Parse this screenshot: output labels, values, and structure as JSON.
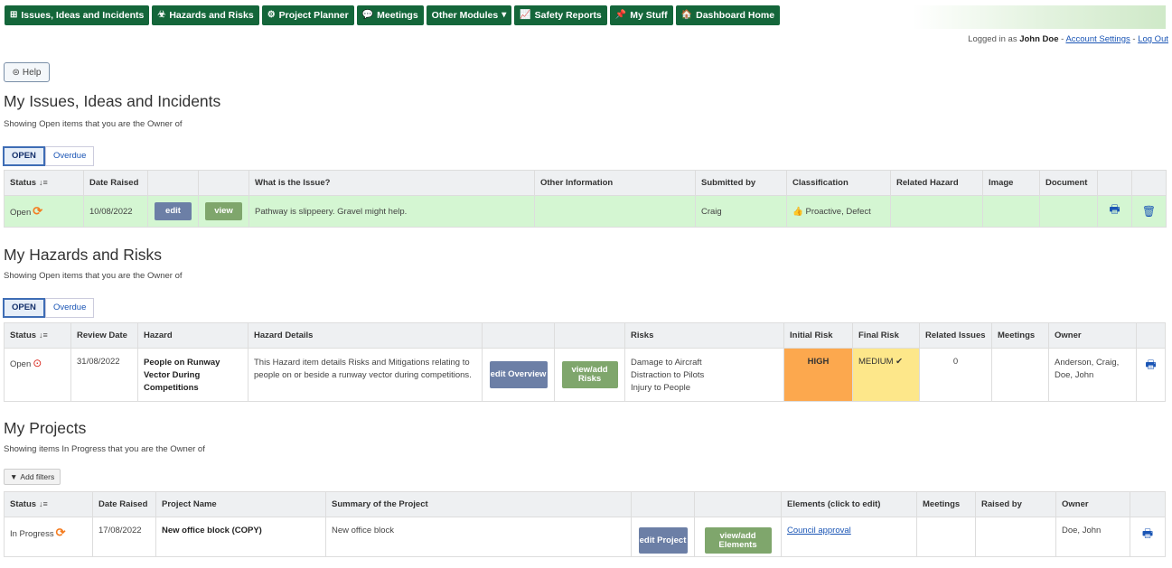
{
  "nav": {
    "items": [
      {
        "icon": "plus-square-icon",
        "glyph": "⊞",
        "label": "Issues, Ideas and Incidents"
      },
      {
        "icon": "biohazard-icon",
        "glyph": "☣",
        "label": "Hazards and Risks"
      },
      {
        "icon": "cogs-icon",
        "glyph": "⚙",
        "label": "Project Planner"
      },
      {
        "icon": "comments-icon",
        "glyph": "💬",
        "label": "Meetings"
      },
      {
        "icon": "caret-down-icon",
        "glyph": "▾",
        "label": "Other Modules"
      },
      {
        "icon": "chart-line-icon",
        "glyph": "📈",
        "label": "Safety Reports"
      },
      {
        "icon": "thumbtack-icon",
        "glyph": "📌",
        "label": "My Stuff"
      },
      {
        "icon": "home-icon",
        "glyph": "🏠",
        "label": "Dashboard Home"
      }
    ]
  },
  "account": {
    "prefix": "Logged in as",
    "user": "John Doe",
    "sep1": "-",
    "settings_label": "Account Settings",
    "sep2": "-",
    "logout_label": "Log Out"
  },
  "help": {
    "glyph": "⊜",
    "label": "Help"
  },
  "issues": {
    "title": "My Issues, Ideas and Incidents",
    "subtitle": "Showing Open items that you are the Owner of",
    "tabs": [
      "OPEN",
      "Overdue"
    ],
    "headers": [
      "Status",
      "Date Raised",
      "",
      "",
      "What is the Issue?",
      "Other Information",
      "Submitted by",
      "Classification",
      "Related Hazard",
      "Image",
      "Document",
      "",
      ""
    ],
    "row": {
      "status": "Open",
      "date": "10/08/2022",
      "edit": "edit",
      "view": "view",
      "issue": "Pathway is slippeery. Gravel might help.",
      "other": "",
      "submitted": "Craig",
      "classification": "Proactive, Defect"
    }
  },
  "hazards": {
    "title": "My Hazards and Risks",
    "subtitle": "Showing Open items that you are the Owner of",
    "tabs": [
      "OPEN",
      "Overdue"
    ],
    "headers": [
      "Status",
      "Review Date",
      "Hazard",
      "Hazard Details",
      "",
      "",
      "Risks",
      "Initial Risk",
      "Final Risk",
      "Related Issues",
      "Meetings",
      "Owner",
      ""
    ],
    "row": {
      "status": "Open",
      "date": "31/08/2022",
      "hazard": "People on Runway Vector During Competitions",
      "details": "This Hazard item details Risks and Mitigations relating to people on or beside a runway vector during competitions.",
      "edit": "edit Overview",
      "view": "view/add Risks",
      "risks": [
        "Damage to Aircraft",
        "Distraction to Pilots",
        "Injury to People"
      ],
      "initial": "HIGH",
      "final": "MEDIUM",
      "related": "0",
      "meetings": "",
      "owner": "Anderson, Craig, Doe, John"
    }
  },
  "projects": {
    "title": "My Projects",
    "subtitle": "Showing items In Progress that you are the Owner of",
    "filters_label": "Add filters",
    "headers": [
      "Status",
      "Date Raised",
      "Project Name",
      "Summary of the Project",
      "",
      "",
      "Elements (click to edit)",
      "Meetings",
      "Raised by",
      "Owner",
      ""
    ],
    "row": {
      "status": "In Progress",
      "date": "17/08/2022",
      "name": "New office block (COPY)",
      "summary": "New office block",
      "edit": "edit Project",
      "view": "view/add Elements",
      "element": "Council approval",
      "meetings": "",
      "raised_by": "",
      "owner": "Doe, John"
    }
  }
}
